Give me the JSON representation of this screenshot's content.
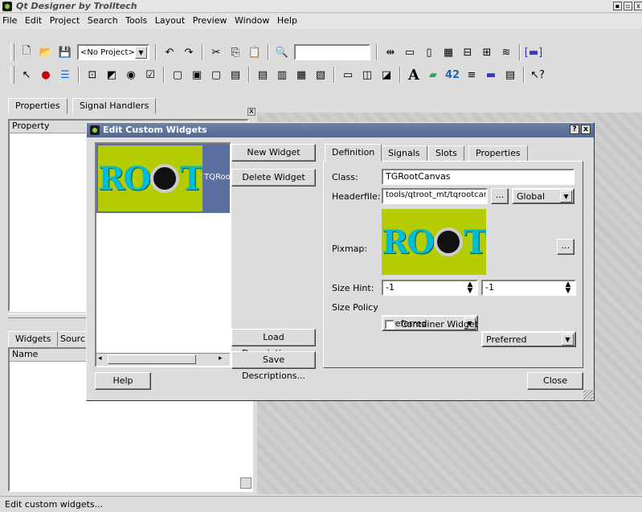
{
  "window": {
    "title": "Qt Designer by Trolltech",
    "buttons": [
      "▪",
      "▫",
      "x"
    ]
  },
  "menubar": [
    {
      "label": "File"
    },
    {
      "label": "Edit"
    },
    {
      "label": "Project"
    },
    {
      "label": "Search"
    },
    {
      "label": "Tools"
    },
    {
      "label": "Layout"
    },
    {
      "label": "Preview"
    },
    {
      "label": "Window"
    },
    {
      "label": "Help"
    }
  ],
  "toolbar": {
    "project_combo": "<No Project>",
    "search_value": ""
  },
  "left_panel": {
    "tabs_top": [
      "Properties",
      "Signal Handlers"
    ],
    "property_header": "Property",
    "tabs_bottom": [
      "Widgets",
      "Sourc"
    ],
    "name_header": "Name"
  },
  "dialog": {
    "title": "Edit Custom Widgets",
    "title_buttons": [
      "?",
      "x"
    ],
    "list_item_label": "TQRoo",
    "buttons": {
      "new_widget": "New Widget",
      "delete_widget": "Delete Widget",
      "load_descriptions": "Load Descriptions...",
      "save_descriptions": "Save Descriptions...",
      "help": "Help",
      "close": "Close",
      "browse_header": "...",
      "browse_pixmap": "..."
    },
    "tabs": [
      "Definition",
      "Signals",
      "Slots",
      "Properties"
    ],
    "definition": {
      "class_label": "Class:",
      "class_value": "TGRootCanvas",
      "headerfile_label": "Headerfile:",
      "headerfile_value": "tools/qtroot_mt/tqrootcanvas.h",
      "scope_value": "Global",
      "pixmap_label": "Pixmap:",
      "sizehint_label": "Size Hint:",
      "sizehint_w": "-1",
      "sizehint_h": "-1",
      "sizepolicy_label": "Size Policy",
      "sizepolicy_h": "Preferred",
      "sizepolicy_v": "Preferred",
      "container_label": "Container Widget",
      "container_checked": false
    },
    "logo_text": {
      "left": "RO",
      "right": "T"
    }
  },
  "statusbar": {
    "text": "Edit custom widgets..."
  },
  "colors": {
    "title_blue": "#5f739a",
    "logo_green": "#b4cc00",
    "logo_cyan": "#00bcd4"
  }
}
